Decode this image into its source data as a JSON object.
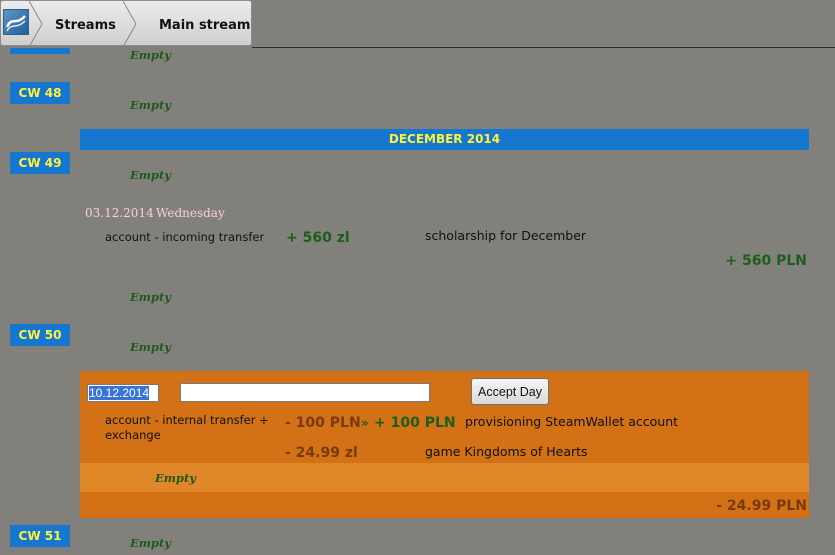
{
  "breadcrumb": {
    "items": [
      {
        "label": "Streams"
      },
      {
        "label": "Main stream"
      }
    ]
  },
  "calendar": {
    "empty_label": "Empty",
    "weeks": {
      "cw48": "CW 48",
      "cw49": "CW 49",
      "cw50": "CW 50",
      "cw51": "CW 51"
    },
    "month_header": "DECEMBER 2014",
    "day_0312": {
      "date": "03.12.2014",
      "weekday": "Wednesday",
      "type": "account - incoming transfer",
      "amount": "+ 560 zl",
      "description": "scholarship for December",
      "total": "+ 560 PLN"
    },
    "current_day": {
      "date_value": "10.12.2014",
      "note_value": "",
      "accept_label": "Accept Day",
      "tx1": {
        "type_line1": "account - internal transfer +",
        "type_line2": "exchange",
        "amount_out": "- 100 PLN",
        "arrow": "»",
        "amount_in": "+ 100 PLN",
        "description": "provisioning SteamWallet account"
      },
      "tx2": {
        "amount": "- 24.99 zl",
        "description": "game Kingdoms of Hearts"
      },
      "total": "- 24.99 PLN"
    }
  },
  "colors": {
    "background": "#82807a",
    "week_badge": "#1677d1",
    "week_text": "#fff23d",
    "current_day": "#d27115",
    "positive": "#1c5e1c",
    "negative": "#7a3a10"
  }
}
